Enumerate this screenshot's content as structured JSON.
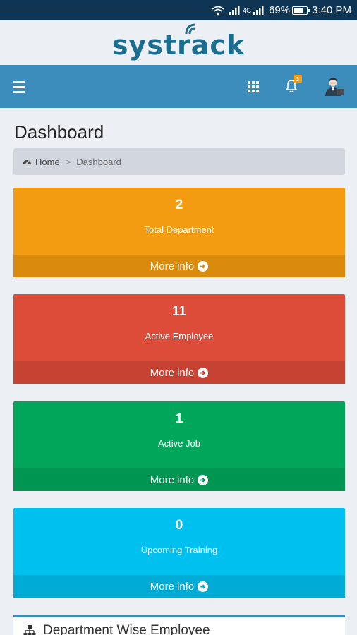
{
  "status_bar": {
    "battery": "69%",
    "time": "3:40 PM",
    "network": "4G"
  },
  "app": {
    "logo": "systrack"
  },
  "navbar": {
    "notifications_count": "3"
  },
  "page": {
    "title": "Dashboard"
  },
  "breadcrumb": {
    "home": "Home",
    "separator": ">",
    "current": "Dashboard"
  },
  "cards": [
    {
      "count": "2",
      "label": "Total Department",
      "link": "More info",
      "color": "#f39c12"
    },
    {
      "count": "11",
      "label": "Active Employee",
      "link": "More info",
      "color": "#dd4b39"
    },
    {
      "count": "1",
      "label": "Active Job",
      "link": "More info",
      "color": "#00a65a"
    },
    {
      "count": "0",
      "label": "Upcoming Training",
      "link": "More info",
      "color": "#00c0ef"
    }
  ],
  "panel": {
    "title": "Department Wise Employee"
  },
  "icons": {
    "menu": "hamburger-icon",
    "apps": "grid-icon",
    "notifications": "bell-icon",
    "user": "avatar-icon",
    "home": "dashboard-icon",
    "more": "arrow-circle-right-icon",
    "panel": "sitemap-icon"
  }
}
